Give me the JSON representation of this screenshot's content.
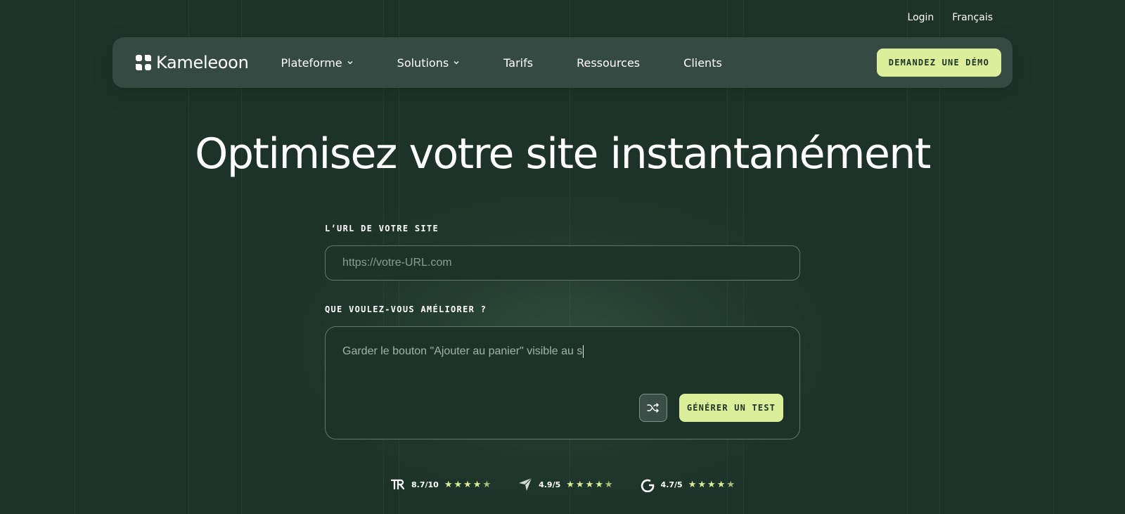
{
  "topbar": {
    "login": "Login",
    "language": "Français"
  },
  "navbar": {
    "brand": "Kameleoon",
    "items": [
      {
        "label": "Plateforme",
        "has_dropdown": true
      },
      {
        "label": "Solutions",
        "has_dropdown": true
      },
      {
        "label": "Tarifs",
        "has_dropdown": false
      },
      {
        "label": "Ressources",
        "has_dropdown": false
      },
      {
        "label": "Clients",
        "has_dropdown": false
      }
    ],
    "cta": "DEMANDEZ UNE DÉMO"
  },
  "hero": {
    "title": "Optimisez votre site instantanément"
  },
  "form": {
    "url_label": "L’URL DE VOTRE SITE",
    "url_placeholder": "https://votre-URL.com",
    "url_value": "",
    "improve_label": "QUE VOULEZ-VOUS AMÉLIORER ?",
    "improve_value": "Garder le bouton \"Ajouter au panier\" visible au s",
    "shuffle_icon": "shuffle-icon",
    "generate_label": "GÉNÉRER UN TEST"
  },
  "ratings": [
    {
      "source_icon": "trustradius-icon",
      "value": "8.7/10",
      "stars": 4.5
    },
    {
      "source_icon": "capterra-icon",
      "value": "4.9/5",
      "stars": 4.5
    },
    {
      "source_icon": "g2-icon",
      "value": "4.7/5",
      "stars": 4.5
    }
  ],
  "colors": {
    "background": "#1d3329",
    "navbar": "#354a43",
    "accent": "#dbee99",
    "border": "#60776b"
  }
}
